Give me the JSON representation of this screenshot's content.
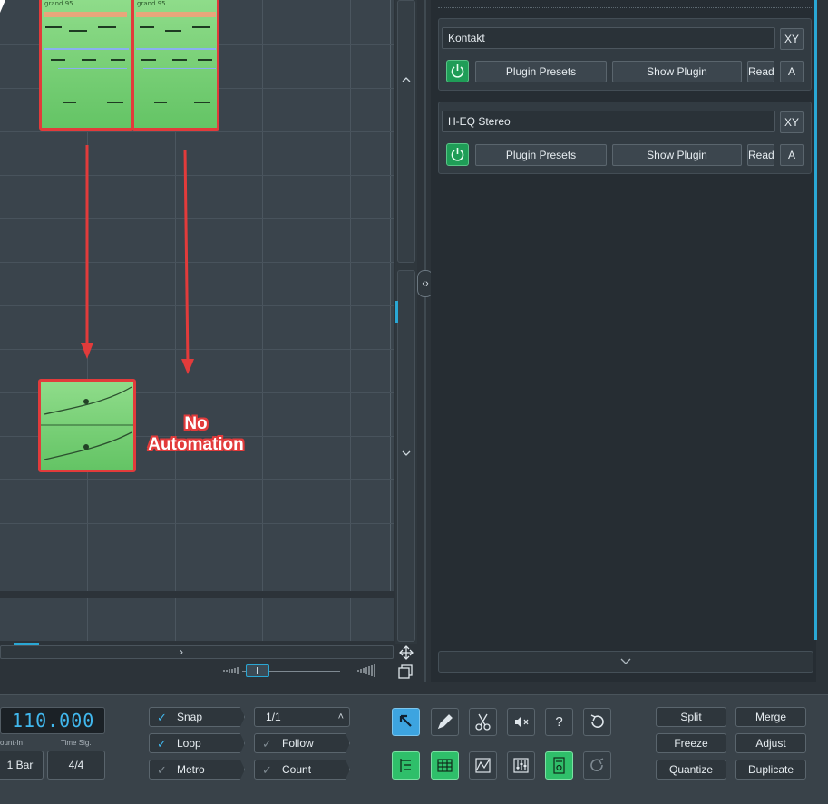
{
  "clips": {
    "top_label_1": "grand 95",
    "top_label_2": "grand 95"
  },
  "annotation": {
    "line1": "No",
    "line2": "Automation"
  },
  "inspector": {
    "plugins": [
      {
        "name": "Kontakt",
        "xy": "XY",
        "presets": "Plugin Presets",
        "show": "Show Plugin",
        "read": "Read",
        "a": "A"
      },
      {
        "name": "H-EQ Stereo",
        "xy": "XY",
        "presets": "Plugin Presets",
        "show": "Show Plugin",
        "read": "Read",
        "a": "A"
      }
    ]
  },
  "transport": {
    "tempo": "110.000",
    "count_in_label": "ount-In",
    "time_sig_label": "Time Sig.",
    "count_in_value": "1 Bar",
    "time_sig_value": "4/4"
  },
  "options": {
    "snap": "Snap",
    "loop": "Loop",
    "metro": "Metro",
    "follow": "Follow",
    "count": "Count",
    "quantize_value": "1/1"
  },
  "tools": {
    "help_glyph": "?"
  },
  "edit_actions": {
    "split": "Split",
    "merge": "Merge",
    "freeze": "Freeze",
    "adjust": "Adjust",
    "quantize": "Quantize",
    "duplicate": "Duplicate"
  },
  "colors": {
    "accent": "#2aa7d4",
    "clip_green": "#6fcc6b",
    "annotation_red": "#e23b3b",
    "power_green": "#1f9d57"
  }
}
